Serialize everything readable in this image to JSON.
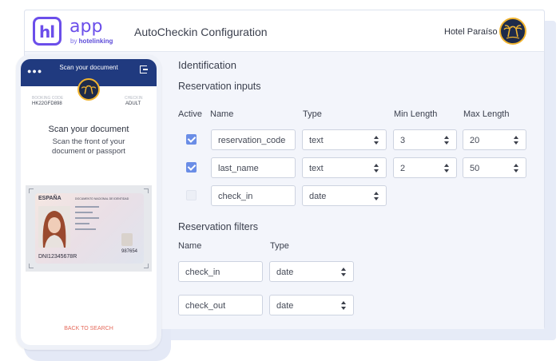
{
  "brand": {
    "logo_mark": "hl",
    "app_name": "app",
    "by_prefix": "by ",
    "by_company": "hotelinking"
  },
  "header": {
    "title": "AutoCheckin Configuration",
    "hotel_name": "Hotel Paraíso",
    "hotel_logo_icon": "palm-tree-logo"
  },
  "identification": {
    "title": "Identification",
    "reservation_inputs": {
      "title": "Reservation inputs",
      "columns": {
        "active": "Active",
        "name": "Name",
        "type": "Type",
        "min_length": "Min Length",
        "max_length": "Max Length"
      },
      "rows": [
        {
          "active": true,
          "name": "reservation_code",
          "type": "text",
          "min_length": "3",
          "max_length": "20"
        },
        {
          "active": true,
          "name": "last_name",
          "type": "text",
          "min_length": "2",
          "max_length": "50"
        },
        {
          "active": false,
          "name": "check_in",
          "type": "date"
        }
      ]
    },
    "reservation_filters": {
      "title": "Reservation filters",
      "columns": {
        "name": "Name",
        "type": "Type"
      },
      "rows": [
        {
          "name": "check_in",
          "type": "date"
        },
        {
          "name": "check_out",
          "type": "date"
        }
      ]
    }
  },
  "phone": {
    "header_title": "Scan your document",
    "menu_icon": "dots-icon",
    "exit_icon": "exit-icon",
    "booking_label": "BOOKING CODE",
    "booking_value": "HK22GFD898",
    "guest_label": "CHECKIN",
    "guest_value": "ADULT",
    "heading": "Scan your document",
    "subheading": "Scan the front of your document or passport",
    "id_card": {
      "country": "ESPAÑA",
      "doc_title": "DOCUMENTO NACIONAL DE IDENTIDAD",
      "number": "DNI12345678R",
      "code": "987654"
    },
    "back_link": "BACK TO SEARCH"
  },
  "colors": {
    "brand_purple": "#6b4eea",
    "phone_header": "#203a7f",
    "checkbox_active": "#6a8de6",
    "back_link": "#e56a5b"
  }
}
